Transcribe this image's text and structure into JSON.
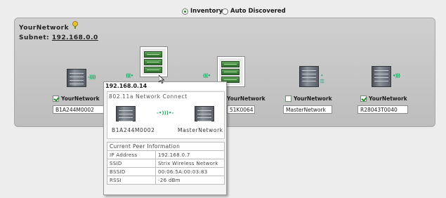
{
  "view_options": {
    "inventory_label": "Inventory",
    "auto_discovered_label": "Auto Discovered",
    "selected": "Inventory"
  },
  "network": {
    "title": "YourNetwork",
    "subnet_label": "Subnet:",
    "subnet_value": "192.168.0.0"
  },
  "devices": [
    {
      "label": "YourNetwork",
      "checked": true,
      "name": "B1A244M0002"
    },
    {
      "label": "YourNetwork",
      "checked": false,
      "name": "51K0064"
    },
    {
      "label": "YourNetwork",
      "checked": true,
      "name": "MasterNetwork"
    },
    {
      "label": "YourNetwork",
      "checked": true,
      "name": "R28043T0040"
    }
  ],
  "popup": {
    "title": "192.168.0.14",
    "connection_heading": "802.11a Network Connect",
    "left_node": "B1A244M0002",
    "right_node": "MasterNetwork",
    "peer_heading": "Current Peer Information",
    "rows": [
      {
        "key": "IP Address",
        "value": "192.168.0.7"
      },
      {
        "key": "SSID",
        "value": "Strix Wireless Network"
      },
      {
        "key": "BSSID",
        "value": "00:06:5A:00:03:83"
      },
      {
        "key": "RSSI",
        "value": "-26 dBm"
      }
    ]
  },
  "colors": {
    "panel_bg": "#c8c8c8",
    "wireless_green": "#2aaa66",
    "radio_selected": "#2c8a2c"
  }
}
